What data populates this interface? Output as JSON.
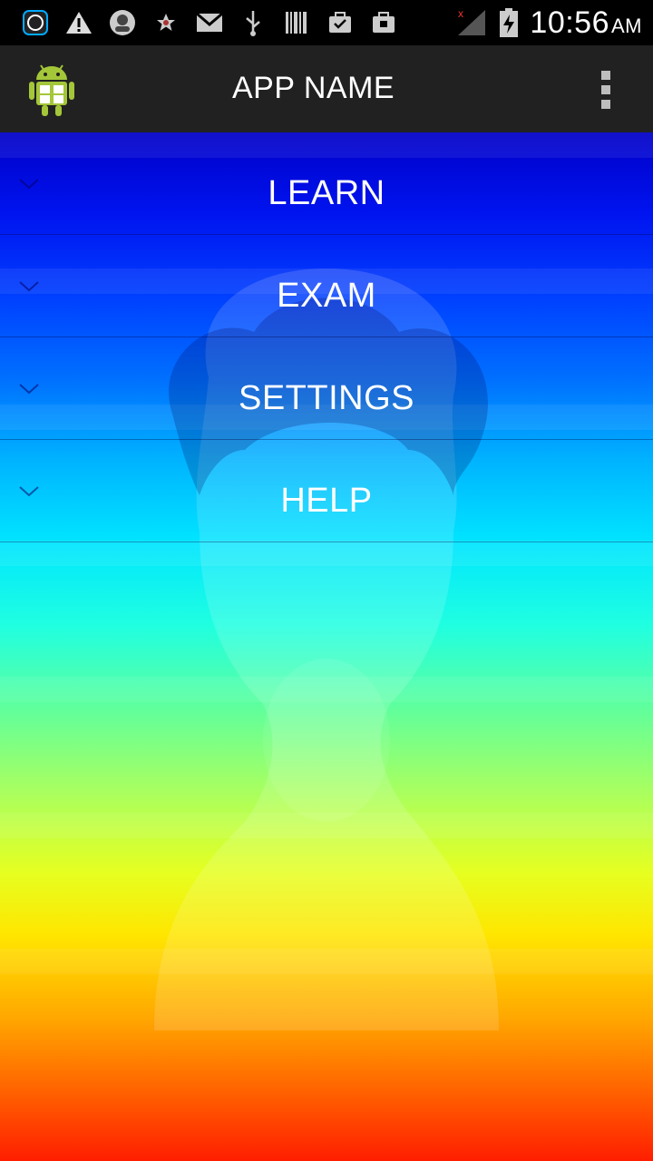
{
  "status_bar": {
    "time": "10:56",
    "ampm": "AM",
    "icons": [
      "app-icon",
      "warning-icon",
      "avatar-icon",
      "star-icon",
      "gmail-icon",
      "usb-icon",
      "barcode-icon",
      "briefcase-icon",
      "briefcase-icon",
      "signal-icon",
      "battery-charging-icon"
    ]
  },
  "action_bar": {
    "title": "APP NAME",
    "logo_icon": "android-icon",
    "overflow_icon": "overflow-menu-icon"
  },
  "menu": {
    "items": [
      {
        "label": "LEARN"
      },
      {
        "label": "EXAM"
      },
      {
        "label": "SETTINGS"
      },
      {
        "label": "HELP"
      }
    ]
  },
  "colors": {
    "action_bar": "#212121",
    "status_bar": "#000000",
    "text": "#ffffff"
  }
}
